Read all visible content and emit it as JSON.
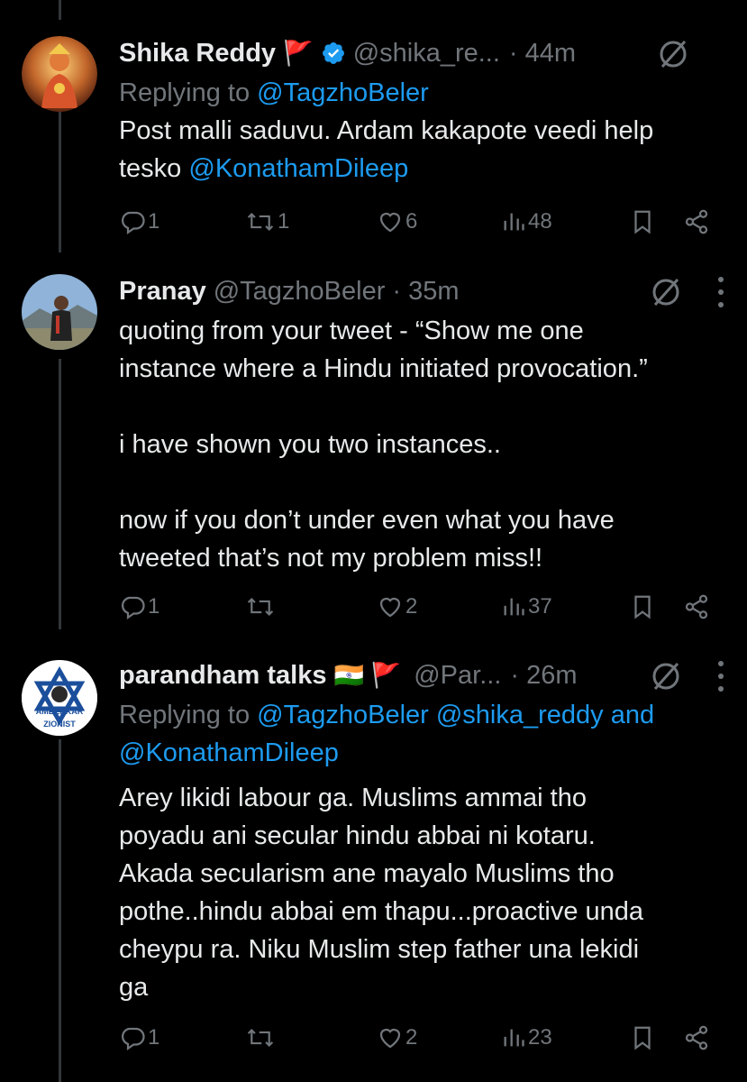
{
  "tweets": [
    {
      "name": "Shika Reddy",
      "emoji": "🚩",
      "verified": true,
      "handle": "@shika_re...",
      "time": "· 44m",
      "replying_prefix": "Replying to",
      "replying_mentions": "@TagzhoBeler",
      "replying_suffix": "",
      "body_text": "Post malli saduvu. Ardam kakapote veedi help\ntesko ",
      "body_mention": "@KonathamDileep",
      "replies": "1",
      "reposts": "1",
      "likes": "6",
      "views": "48"
    },
    {
      "name": "Pranay",
      "emoji": "",
      "verified": false,
      "handle": "@TagzhoBeler",
      "time": "· 35m",
      "body_text": "quoting from your tweet - “Show me one\ninstance where a Hindu initiated provocation.”\n\ni have shown you two instances..\n\nnow if you don’t under even what you have\ntweeted that’s not my problem miss!!",
      "replies": "1",
      "reposts": "",
      "likes": "2",
      "views": "37"
    },
    {
      "name": "parandham talks",
      "emoji": "🇮🇳 🚩",
      "verified": false,
      "handle": "@Par...",
      "time": "· 26m",
      "replying_prefix": "Replying to",
      "replying_mentions": "@TagzhoBeler @shika_reddy",
      "replying_and": " and",
      "replying_mentions2": "@KonathamDileep",
      "avatar_text_top": "AMBEDKAR",
      "avatar_text_bottom": "ZIONIST",
      "body_text": "Arey likidi labour ga. Muslims ammai tho\npoyadu ani secular hindu abbai ni kotaru.\nAkada secularism ane mayalo Muslims tho\npothe..hindu abbai em thapu...proactive unda\ncheypu ra. Niku Muslim step father una lekidi\nga",
      "replies": "1",
      "reposts": "",
      "likes": "2",
      "views": "23"
    }
  ],
  "colors": {
    "background": "#000000",
    "text": "#e7e9ea",
    "muted": "#71767b",
    "link": "#1d9bf0",
    "verified": "#1d9bf0",
    "flag": "#e0245e"
  },
  "icons": [
    "reply-icon",
    "repost-icon",
    "like-icon",
    "views-icon",
    "bookmark-icon",
    "share-icon",
    "grok-icon",
    "more-icon",
    "verified-badge-icon"
  ]
}
